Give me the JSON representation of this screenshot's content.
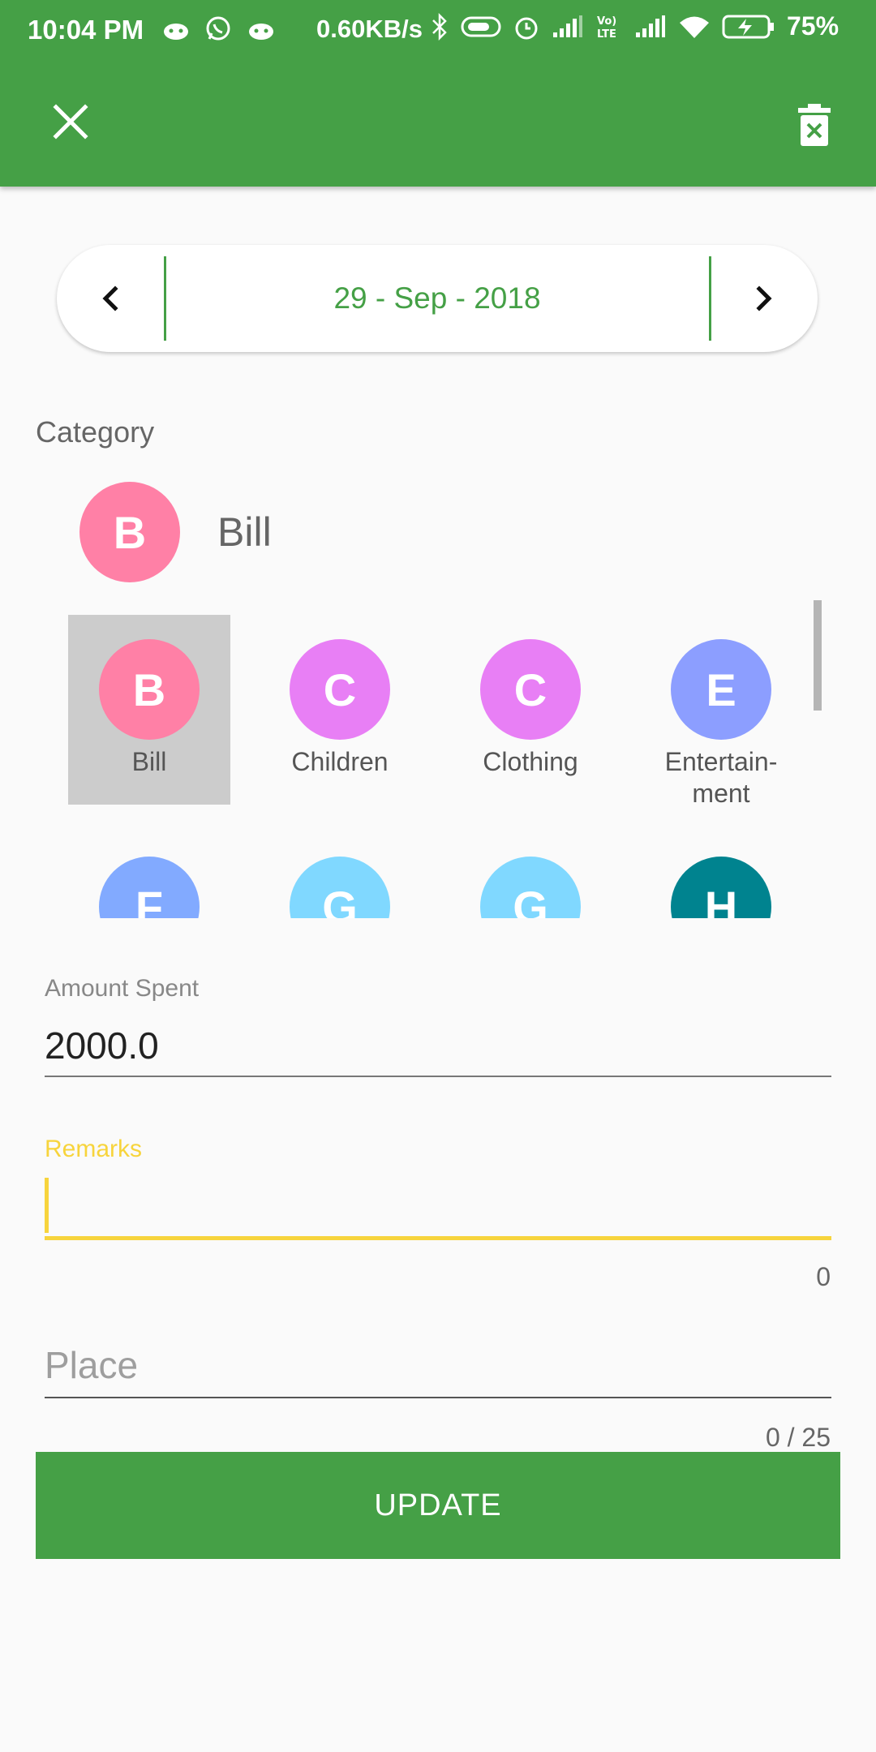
{
  "status_bar": {
    "time": "10:04 PM",
    "notification_icons": [
      "android-icon",
      "whatsapp-icon",
      "android-icon"
    ],
    "net_speed": "0.60KB/s",
    "battery_percent": "75%",
    "right_icons": [
      "bluetooth-icon",
      "toggle-icon",
      "alarm-icon",
      "signal-icon",
      "volte-icon",
      "signal-icon",
      "wifi-icon",
      "battery-charging-icon"
    ]
  },
  "app_bar": {
    "close_icon": "close-icon",
    "delete_icon": "delete-icon",
    "color": "#45a046"
  },
  "date_selector": {
    "date": "29 - Sep - 2018",
    "prev_icon": "chevron-left-icon",
    "next_icon": "chevron-right-icon"
  },
  "category": {
    "label": "Category",
    "selected": {
      "letter": "B",
      "name": "Bill",
      "color": "#ff80a6"
    },
    "items": [
      {
        "letter": "B",
        "name": "Bill",
        "color": "#ff80a6",
        "selected": true
      },
      {
        "letter": "C",
        "name": "Children",
        "color": "#e87ff5",
        "selected": false
      },
      {
        "letter": "C",
        "name": "Clothing",
        "color": "#e87ff5",
        "selected": false
      },
      {
        "letter": "E",
        "name": "Entertain-\nment",
        "color": "#8c9eff",
        "selected": false
      },
      {
        "letter": "F",
        "name": "",
        "color": "#82aaff",
        "selected": false
      },
      {
        "letter": "G",
        "name": "",
        "color": "#80d8ff",
        "selected": false
      },
      {
        "letter": "G",
        "name": "",
        "color": "#80d8ff",
        "selected": false
      },
      {
        "letter": "H",
        "name": "",
        "color": "#00838f",
        "selected": false
      }
    ]
  },
  "amount": {
    "label": "Amount Spent",
    "value": "2000.0"
  },
  "remarks": {
    "label": "Remarks",
    "value": "",
    "counter": "0",
    "accent": "#f7d43c"
  },
  "place": {
    "placeholder": "Place",
    "counter": "0 / 25"
  },
  "update_button": {
    "label": "UPDATE"
  }
}
